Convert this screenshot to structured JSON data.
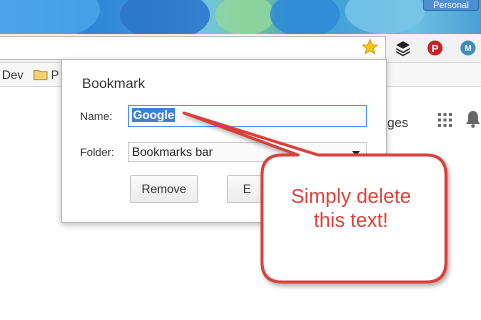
{
  "browser": {
    "persona_label": "Personal",
    "icons": [
      "star-icon",
      "layers-icon",
      "pinterest-icon",
      "m-icon"
    ],
    "colors": {
      "star": "#f5c518",
      "pinterest": "#cb2027",
      "m_badge": "#3c8dbc"
    }
  },
  "bookmarks_bar": {
    "items": [
      {
        "label": "Dev"
      },
      {
        "label": "P"
      }
    ]
  },
  "page": {
    "right_label": "ages"
  },
  "dialog": {
    "title": "Bookmark",
    "name_label": "Name:",
    "name_value": "Google",
    "folder_label": "Folder:",
    "folder_value": "Bookmarks bar",
    "remove_label": "Remove",
    "edit_label": "E"
  },
  "callout": {
    "line1": "Simply delete",
    "line2": "this text!",
    "color": "#d9403a"
  }
}
